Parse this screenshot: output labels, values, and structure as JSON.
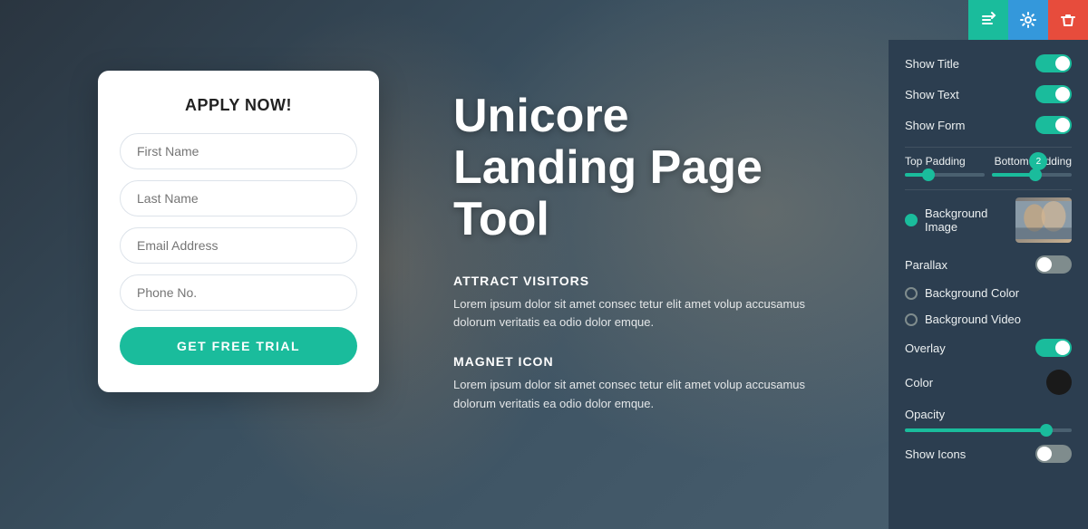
{
  "toolbar": {
    "swap_icon": "⇄",
    "gear_icon": "⚙",
    "trash_icon": "🗑"
  },
  "form": {
    "title": "APPLY NOW!",
    "first_name_placeholder": "First Name",
    "last_name_placeholder": "Last Name",
    "email_placeholder": "Email Address",
    "phone_placeholder": "Phone No.",
    "button_label": "GET FREE TRIAL"
  },
  "hero": {
    "title_line1": "Unicore",
    "title_line2": "Landing Page Tool",
    "section1_heading": "ATTRACT VISITORS",
    "section1_text": "Lorem ipsum dolor sit amet consec tetur elit amet volup accusamus dolorum veritatis ea odio dolor emque.",
    "section2_heading": "MAGNET ICON",
    "section2_text": "Lorem ipsum dolor sit amet consec tetur elit amet volup accusamus dolorum veritatis ea odio dolor emque."
  },
  "settings": {
    "show_title_label": "Show Title",
    "show_title_on": true,
    "show_text_label": "Show Text",
    "show_text_on": true,
    "show_form_label": "Show Form",
    "show_form_on": true,
    "top_padding_label": "Top Padding",
    "bottom_padding_label": "Bottom Padding",
    "bottom_padding_value": "2",
    "top_padding_pct": 30,
    "bottom_padding_pct": 55,
    "background_image_label": "Background Image",
    "parallax_label": "Parallax",
    "parallax_on": false,
    "bg_color_label": "Background Color",
    "bg_video_label": "Background Video",
    "overlay_label": "Overlay",
    "overlay_on": true,
    "color_label": "Color",
    "opacity_label": "Opacity",
    "opacity_pct": 85,
    "show_icons_label": "Show Icons",
    "show_icons_on": false
  }
}
